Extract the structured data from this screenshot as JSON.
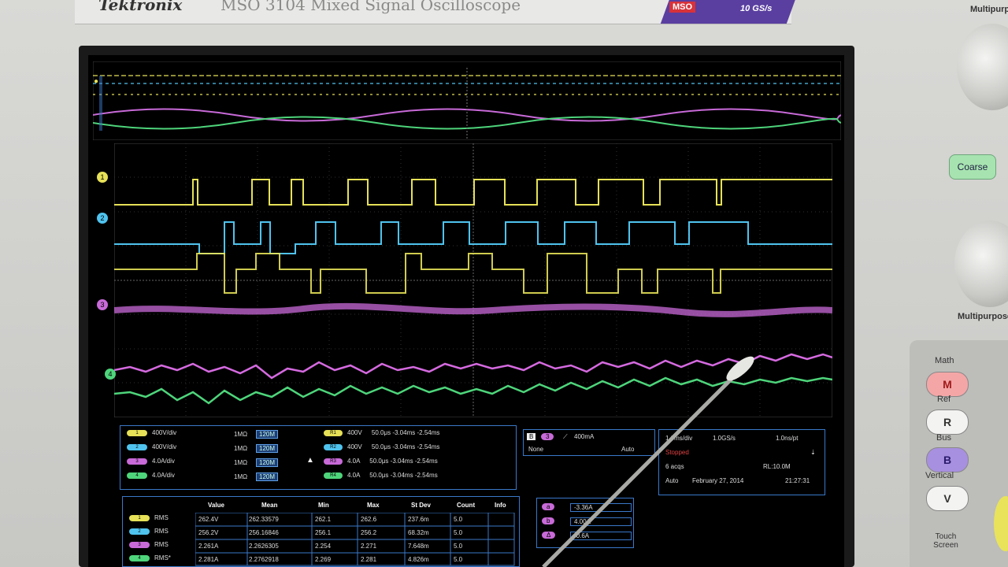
{
  "header": {
    "brand": "Tektronix",
    "model": "MSO 3104 Mixed Signal Oscilloscope",
    "badge": "MSO",
    "sample_rate": "10 GS/s"
  },
  "channels": [
    {
      "label": "1",
      "scale": "400V/div",
      "impedance": "1MΩ",
      "bw": "120M",
      "color": "#e6e157"
    },
    {
      "label": "2",
      "scale": "400V/div",
      "impedance": "1MΩ",
      "bw": "120M",
      "color": "#4fc3ee"
    },
    {
      "label": "3",
      "scale": "4.0A/div",
      "impedance": "1MΩ",
      "bw": "120M",
      "color": "#c86ad8"
    },
    {
      "label": "4",
      "scale": "4.0A/div",
      "impedance": "1MΩ",
      "bw": "120M",
      "color": "#4ed57b"
    }
  ],
  "refs": [
    {
      "name": "R1",
      "scale": "400V",
      "time": "50.0μs",
      "start": "-3.04ms",
      "end": "-2.54ms"
    },
    {
      "name": "R2",
      "scale": "400V",
      "time": "50.0μs",
      "start": "-3.04ms",
      "end": "-2.54ms"
    },
    {
      "name": "R3",
      "scale": "4.0A",
      "time": "50.0μs",
      "start": "-3.04ms",
      "end": "-2.54ms"
    },
    {
      "name": "R4",
      "scale": "4.0A",
      "time": "50.0μs",
      "start": "-3.04ms",
      "end": "-2.54ms"
    }
  ],
  "trigger": {
    "source": "B",
    "ch": "3",
    "level": "400mA",
    "type": "None",
    "mode": "Auto"
  },
  "acquisition": {
    "timebase": "1.0ms/div",
    "rate": "1.0GS/s",
    "point": "1.0ns/pt",
    "state": "Stopped",
    "acqs": "6 acqs",
    "rl": "RL:10.0M",
    "mode": "Auto",
    "date": "February 27, 2014",
    "time": "21:27:31"
  },
  "measure": {
    "headers": [
      "Value",
      "Mean",
      "Min",
      "Max",
      "St Dev",
      "Count",
      "Info"
    ],
    "rows": [
      {
        "ch": "1",
        "type": "RMS",
        "value": "262.4V",
        "mean": "262.33579",
        "min": "262.1",
        "max": "262.6",
        "std": "237.6m",
        "count": "5.0"
      },
      {
        "ch": "2",
        "type": "RMS",
        "value": "256.2V",
        "mean": "256.16846",
        "min": "256.1",
        "max": "256.2",
        "std": "68.32m",
        "count": "5.0"
      },
      {
        "ch": "3",
        "type": "RMS",
        "value": "2.261A",
        "mean": "2.2626305",
        "min": "2.254",
        "max": "2.271",
        "std": "7.648m",
        "count": "5.0"
      },
      {
        "ch": "4",
        "type": "RMS*",
        "value": "2.281A",
        "mean": "2.2762918",
        "min": "2.269",
        "max": "2.281",
        "std": "4.826m",
        "count": "5.0"
      }
    ]
  },
  "cursor": [
    "-3.36A",
    "4.00A",
    "-0.6A"
  ],
  "panel": {
    "multipurpose_a": "Multipurpose",
    "multipurpose_b": "Multipurpose",
    "coarse": "Coarse",
    "math_label": "Math",
    "math_btn": "M",
    "ref_label": "Ref",
    "ref_btn": "R",
    "bus_label": "Bus",
    "bus_btn": "B",
    "vertical_label": "Vertical",
    "vertical_btn": "V",
    "touch": "Touch Screen"
  }
}
